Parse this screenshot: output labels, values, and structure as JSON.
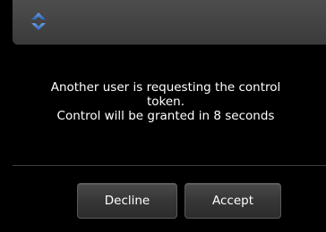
{
  "dialog": {
    "icon": "up-down-arrows-icon",
    "message_lines": [
      "Another user is requesting the control",
      "token.",
      "Control will be granted in 8 seconds"
    ],
    "countdown_seconds": 8,
    "buttons": {
      "decline_label": "Decline",
      "accept_label": "Accept"
    }
  },
  "colors": {
    "background": "#000000",
    "titlebar": "#444444",
    "icon_accent": "#3a78c8",
    "text": "#ffffff"
  }
}
